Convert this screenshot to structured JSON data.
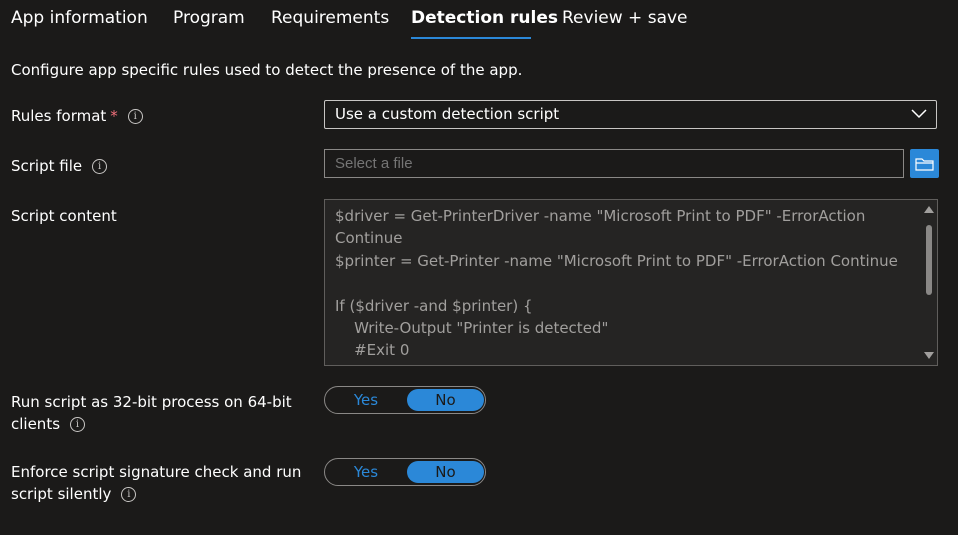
{
  "tabs": [
    {
      "label": "App information"
    },
    {
      "label": "Program"
    },
    {
      "label": "Requirements"
    },
    {
      "label": "Detection rules",
      "active": true
    },
    {
      "label": "Review + save"
    }
  ],
  "description": "Configure app specific rules used to detect the presence of the app.",
  "rules_format": {
    "label": "Rules format",
    "required_mark": "*",
    "info_icon": "i",
    "value": "Use a custom detection script"
  },
  "script_file": {
    "label": "Script file",
    "info_icon": "i",
    "placeholder": "Select a file"
  },
  "script_content": {
    "label": "Script content",
    "text": "$driver = Get-PrinterDriver -name \"Microsoft Print to PDF\" -ErrorAction Continue\n$printer = Get-Printer -name \"Microsoft Print to PDF\" -ErrorAction Continue\n\nIf ($driver -and $printer) {\n    Write-Output \"Printer is detected\"\n    #Exit 0"
  },
  "run_32bit": {
    "label_line1": "Run script as 32-bit process on 64-bit",
    "label_line2": "clients",
    "info_icon": "i",
    "yes": "Yes",
    "no": "No",
    "selected": "No"
  },
  "signature_check": {
    "label_line1": "Enforce script signature check and run",
    "label_line2": "script silently",
    "info_icon": "i",
    "yes": "Yes",
    "no": "No",
    "selected": "No"
  },
  "colors": {
    "background": "#1b1a19",
    "accent": "#2b88d8",
    "required": "#f1707b"
  }
}
